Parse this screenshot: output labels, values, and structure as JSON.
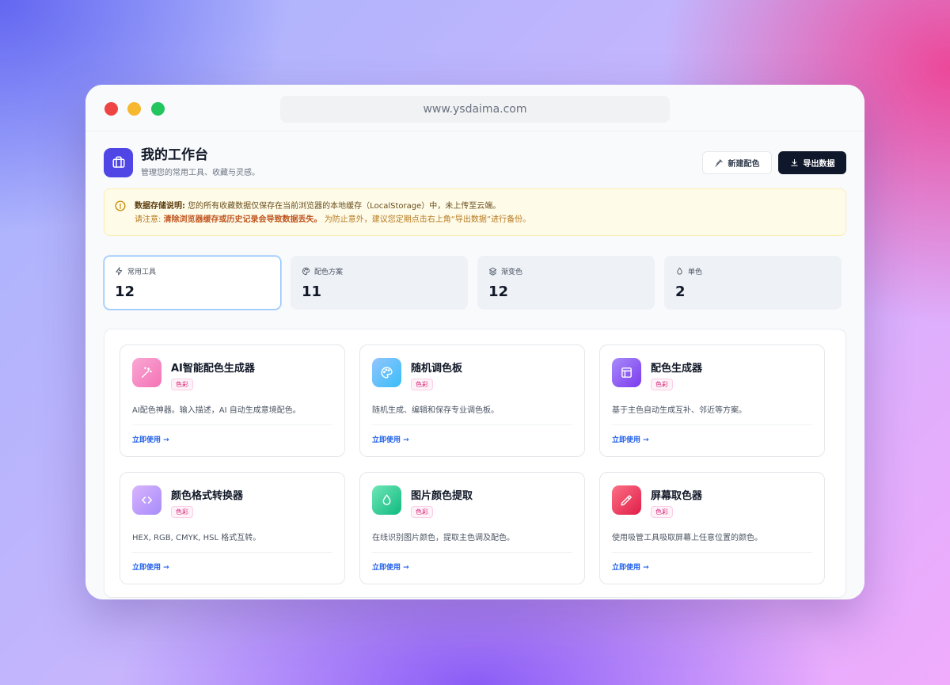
{
  "browser": {
    "url": "www.ysdaima.com"
  },
  "header": {
    "title": "我的工作台",
    "subtitle": "管理您的常用工具、收藏与灵感。",
    "new_palette_label": "新建配色",
    "export_label": "导出数据"
  },
  "notice": {
    "line1_bold": "数据存储说明:",
    "line1_text": "您的所有收藏数据仅保存在当前浏览器的本地缓存（LocalStorage）中，未上传至云端。",
    "line2_prefix": "请注意:",
    "line2_bold": "清除浏览器缓存或历史记录会导致数据丢失。",
    "line2_text": "为防止意外，建议您定期点击右上角“导出数据”进行备份。"
  },
  "stats": [
    {
      "label": "常用工具",
      "value": "12",
      "icon": "lightning-icon"
    },
    {
      "label": "配色方案",
      "value": "11",
      "icon": "palette-icon"
    },
    {
      "label": "渐变色",
      "value": "12",
      "icon": "layers-icon"
    },
    {
      "label": "单色",
      "value": "2",
      "icon": "droplet-icon"
    }
  ],
  "tools": [
    {
      "title": "AI智能配色生成器",
      "tag": "色彩",
      "desc": "AI配色神器。输入描述，AI 自动生成意境配色。",
      "link": "立即使用",
      "icon": "magic-wand-icon"
    },
    {
      "title": "随机调色板",
      "tag": "色彩",
      "desc": "随机生成、编辑和保存专业调色板。",
      "link": "立即使用",
      "icon": "palette-icon"
    },
    {
      "title": "配色生成器",
      "tag": "色彩",
      "desc": "基于主色自动生成互补、邻近等方案。",
      "link": "立即使用",
      "icon": "layout-icon"
    },
    {
      "title": "颜色格式转换器",
      "tag": "色彩",
      "desc": "HEX, RGB, CMYK, HSL 格式互转。",
      "link": "立即使用",
      "icon": "code-icon"
    },
    {
      "title": "图片颜色提取",
      "tag": "色彩",
      "desc": "在线识别图片颜色，提取主色调及配色。",
      "link": "立即使用",
      "icon": "droplet-icon"
    },
    {
      "title": "屏幕取色器",
      "tag": "色彩",
      "desc": "使用吸管工具吸取屏幕上任意位置的颜色。",
      "link": "立即使用",
      "icon": "eyedropper-icon"
    }
  ],
  "colors": {
    "accent": "#4f46e5",
    "dark_button": "#0f172a",
    "link": "#2563eb",
    "tag": "#db2777"
  }
}
